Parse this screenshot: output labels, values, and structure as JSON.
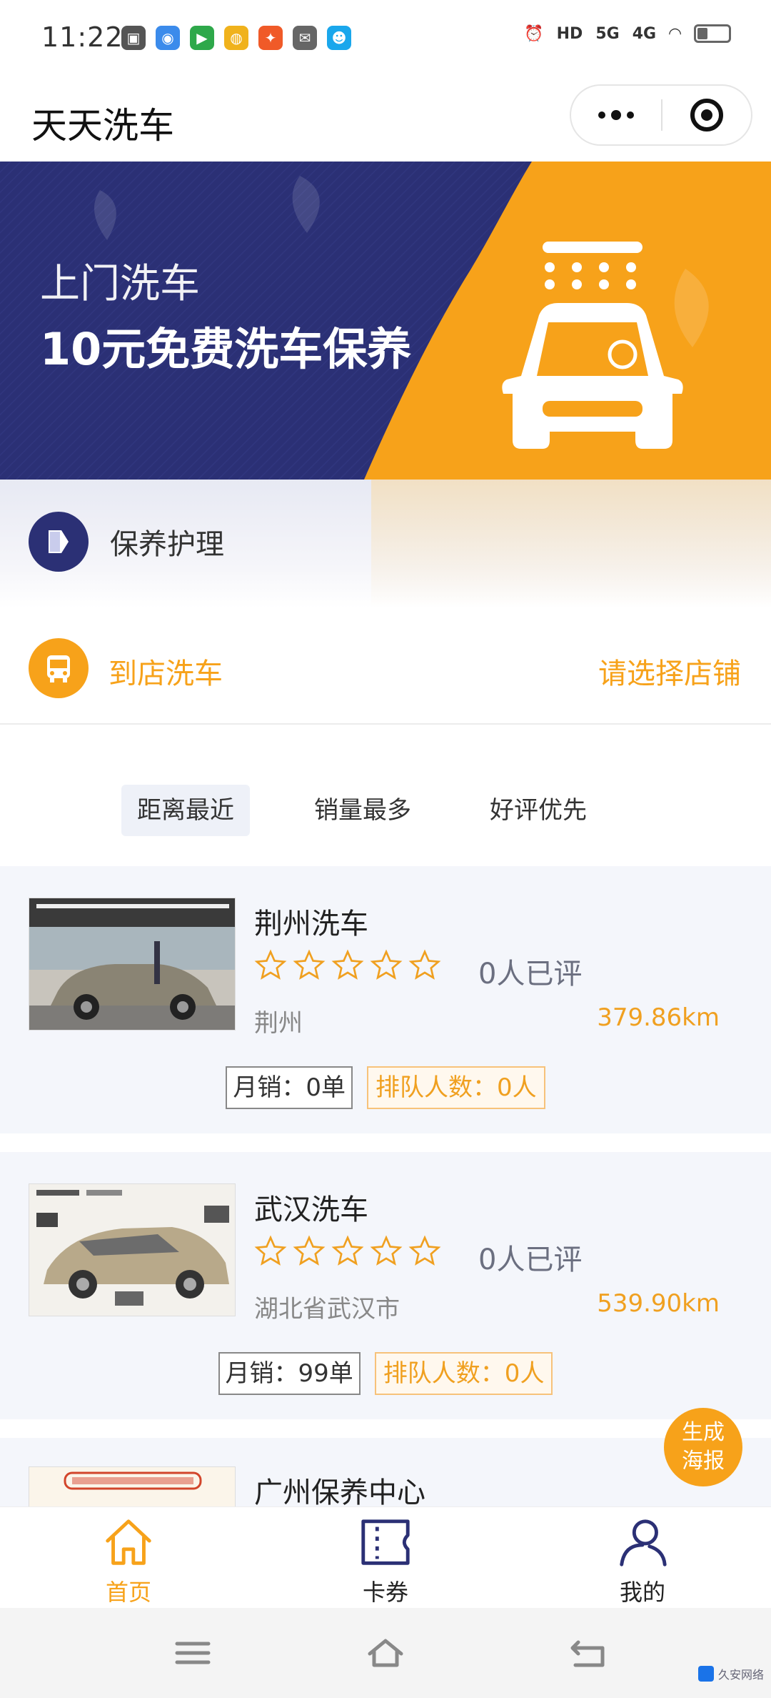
{
  "status_bar": {
    "time": "11:22",
    "network_1": "5G",
    "network_2": "4G",
    "hd_label": "HD"
  },
  "header": {
    "title": "天天洗车"
  },
  "banner": {
    "line1": "上门洗车",
    "line2": "10元免费洗车保养",
    "bg_color": "#2b3075",
    "accent_color": "#f7a21a"
  },
  "services": {
    "care_label": "保养护理",
    "store_wash_label": "到店洗车",
    "select_store_label": "请选择店铺"
  },
  "sort_tabs": [
    {
      "label": "距离最近",
      "active": true
    },
    {
      "label": "销量最多",
      "active": false
    },
    {
      "label": "好评优先",
      "active": false
    }
  ],
  "stores": [
    {
      "name": "荆州洗车",
      "rating": 0,
      "reviews": "0人已评",
      "city": "荆州",
      "distance": "379.86km",
      "sales": "月销：0单",
      "queue": "排队人数：0人"
    },
    {
      "name": "武汉洗车",
      "rating": 0,
      "reviews": "0人已评",
      "city": "湖北省武汉市",
      "distance": "539.90km",
      "sales": "月销：99单",
      "queue": "排队人数：0人"
    },
    {
      "name": "广州保养中心"
    }
  ],
  "poster_button": {
    "line1": "生成",
    "line2": "海报"
  },
  "tab_bar": {
    "home": "首页",
    "coupons": "卡券",
    "mine": "我的",
    "active_color": "#f7a21a",
    "inactive_color": "#2b3075"
  },
  "watermark": "久安网络"
}
